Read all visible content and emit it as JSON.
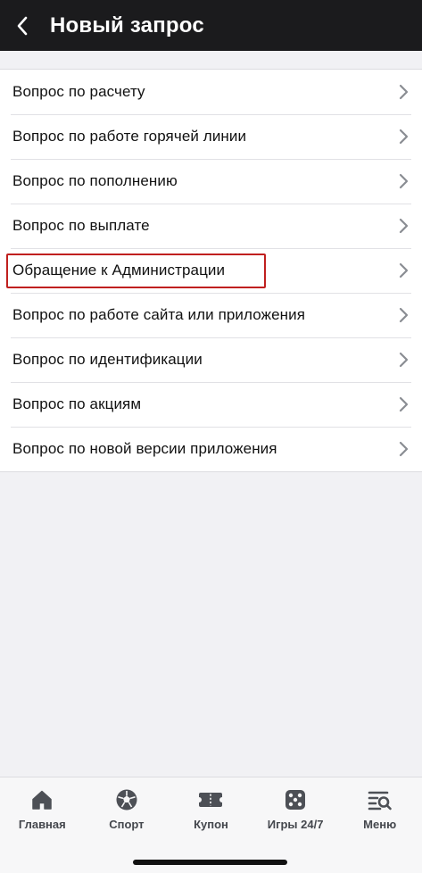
{
  "header": {
    "title": "Новый запрос"
  },
  "items": [
    {
      "label": "Вопрос по расчету"
    },
    {
      "label": "Вопрос по работе горячей линии"
    },
    {
      "label": "Вопрос по пополнению"
    },
    {
      "label": "Вопрос по выплате"
    },
    {
      "label": "Обращение к Администрации",
      "highlighted": true
    },
    {
      "label": "Вопрос по работе сайта или приложения"
    },
    {
      "label": "Вопрос по идентификации"
    },
    {
      "label": "Вопрос по акциям"
    },
    {
      "label": "Вопрос по новой версии приложения"
    }
  ],
  "colors": {
    "header_bg": "#1b1b1d",
    "highlight": "#c0201f",
    "tab_icon": "#4d5056"
  },
  "tabbar": {
    "tabs": [
      {
        "label": "Главная",
        "icon": "home-icon"
      },
      {
        "label": "Спорт",
        "icon": "soccer-ball-icon"
      },
      {
        "label": "Купон",
        "icon": "coupon-ticket-icon"
      },
      {
        "label": "Игры 24/7",
        "icon": "dice-icon"
      },
      {
        "label": "Меню",
        "icon": "menu-search-icon"
      }
    ]
  }
}
